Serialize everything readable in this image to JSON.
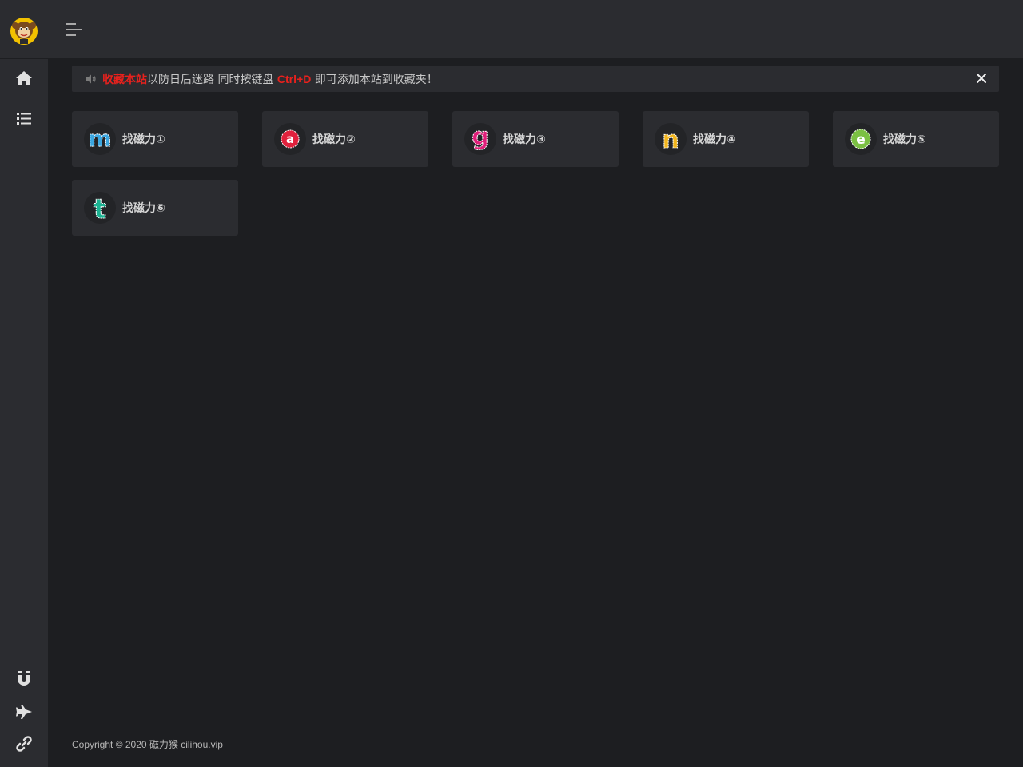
{
  "header": {
    "logo_icon": "monkey-logo-icon",
    "menu_toggle_icon": "menu-toggle-icon"
  },
  "sidebar": {
    "top_items": [
      {
        "icon": "home-icon"
      },
      {
        "icon": "list-icon"
      }
    ],
    "bottom_items": [
      {
        "icon": "magnet-icon"
      },
      {
        "icon": "plane-icon"
      },
      {
        "icon": "link-icon"
      }
    ]
  },
  "notice": {
    "speaker_icon": "speaker-icon",
    "highlight_1": "收藏本站",
    "text_1": "以防日后迷路 同时按键盘 ",
    "highlight_2": "Ctrl+D",
    "text_2": " 即可添加本站到收藏夹！",
    "close_icon": "close-icon"
  },
  "cards": [
    {
      "letter": "m",
      "color": "#3aa6e0",
      "label": "找磁力①"
    },
    {
      "letter": "a",
      "color": "#e0213d",
      "label": "找磁力②"
    },
    {
      "letter": "g",
      "color": "#e01f7a",
      "label": "找磁力③"
    },
    {
      "letter": "n",
      "color": "#f2b51d",
      "label": "找磁力④"
    },
    {
      "letter": "e",
      "color": "#7bc043",
      "label": "找磁力⑤"
    },
    {
      "letter": "t",
      "color": "#1db393",
      "label": "找磁力⑥"
    }
  ],
  "footer": {
    "copyright": "Copyright © 2020 磁力猴 cilihou.vip"
  }
}
